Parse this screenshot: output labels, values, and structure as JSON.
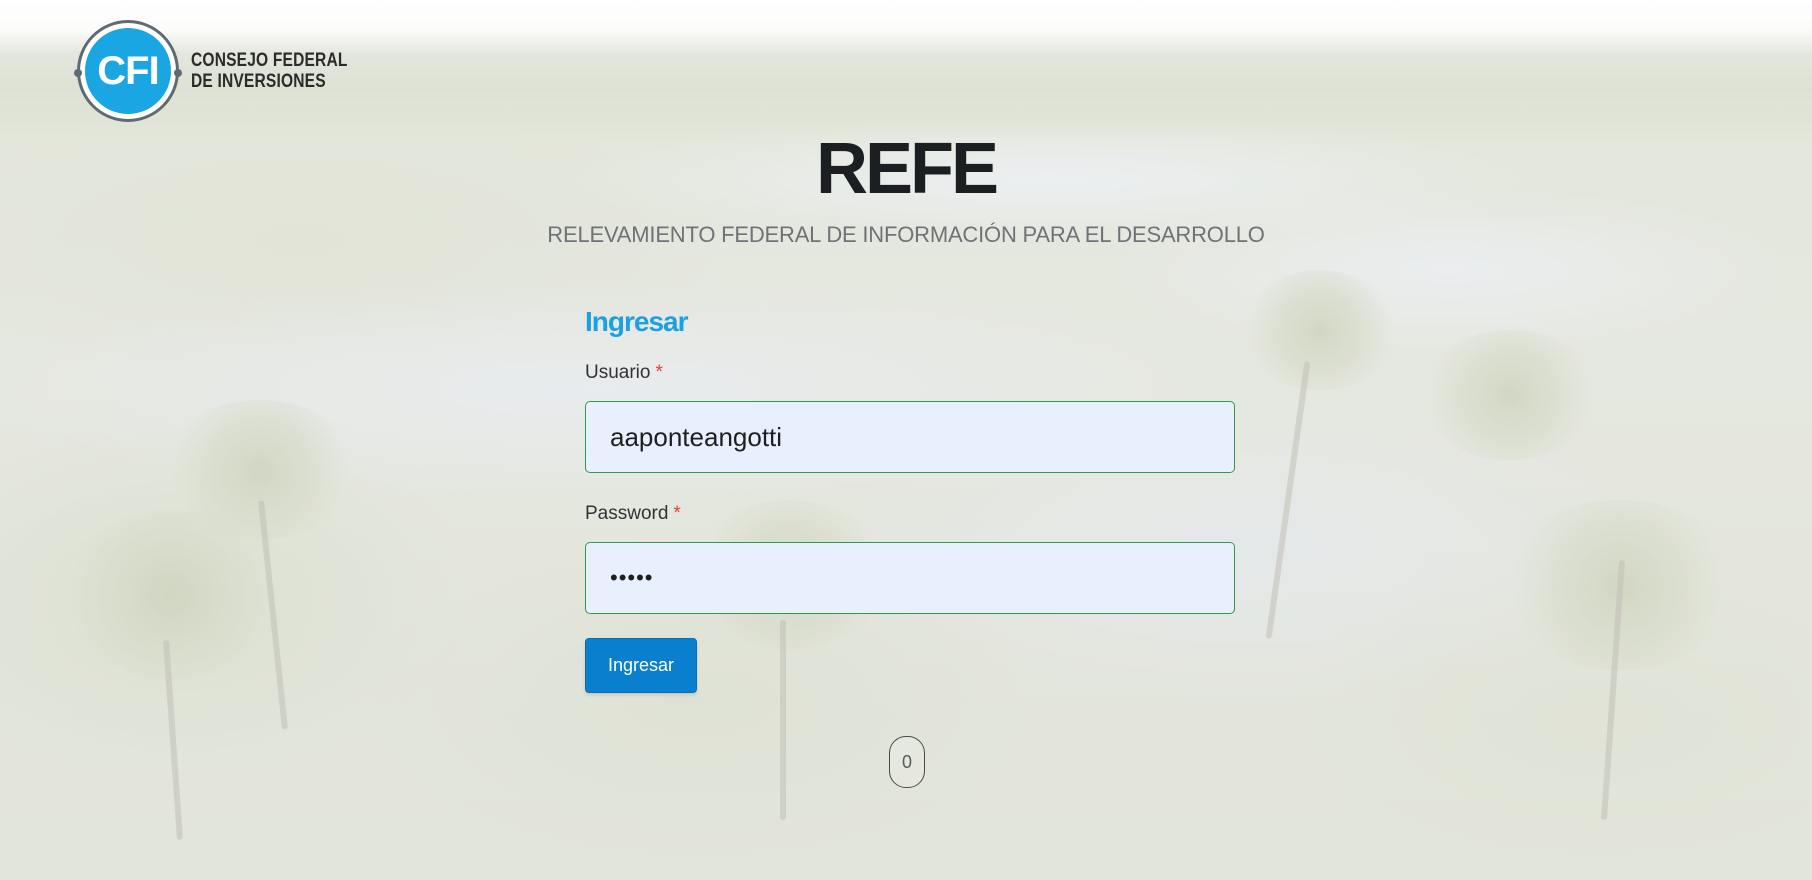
{
  "logo": {
    "abbr": "CFI",
    "line1": "CONSEJO FEDERAL",
    "line2": "DE INVERSIONES"
  },
  "header": {
    "title": "REFE",
    "subtitle": "RELEVAMIENTO FEDERAL DE INFORMACIÓN PARA EL DESARROLLO"
  },
  "form": {
    "title": "Ingresar",
    "user_label": "Usuario",
    "user_value": "aaponteangotti",
    "password_label": "Password",
    "password_value": "•••••",
    "required_mark": "*",
    "submit_label": "Ingresar"
  },
  "counter": {
    "value": "0"
  },
  "colors": {
    "accent": "#1ba1df",
    "button": "#0a7fcd",
    "input_bg": "#e8f0fe",
    "input_border": "#2f9b4a",
    "required": "#e0433a"
  }
}
